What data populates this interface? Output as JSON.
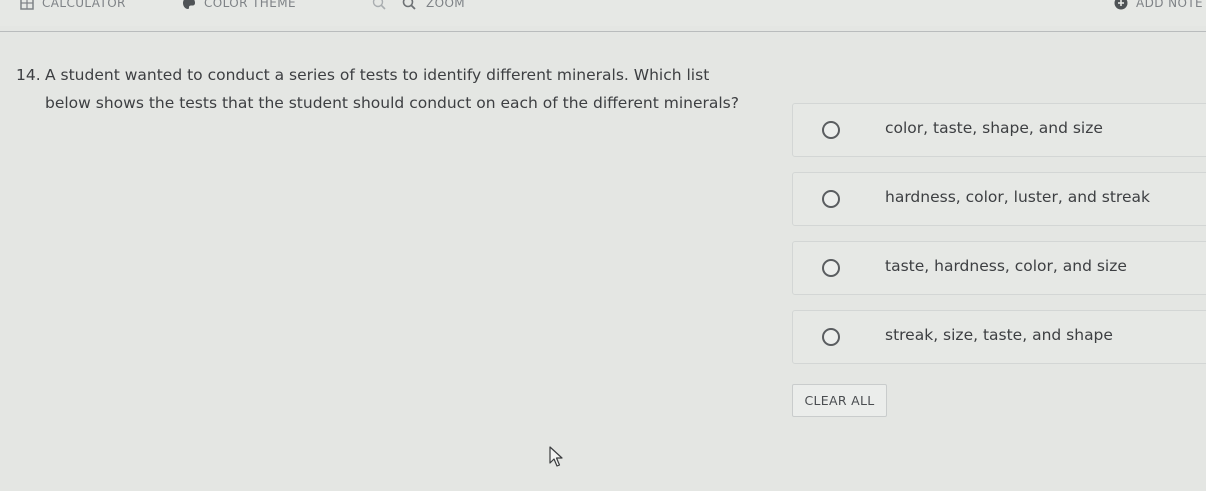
{
  "toolbar": {
    "calculator_label": "CALCULATOR",
    "color_theme_label": "COLOR THEME",
    "zoom_label": "ZOOM",
    "add_note_label": "ADD NOTE",
    "icons": [
      "calculator-icon",
      "palette-icon",
      "zoom-out-icon",
      "zoom-in-icon",
      "plus-circle-icon"
    ]
  },
  "question": {
    "number": "14.",
    "text": "A student wanted to conduct a series of tests to identify different minerals. Which list below shows the tests that the student should conduct on each of the different minerals?"
  },
  "options": [
    {
      "label": "color, taste, shape, and size",
      "selected": false
    },
    {
      "label": "hardness, color, luster, and streak",
      "selected": false
    },
    {
      "label": "taste, hardness, color, and size",
      "selected": false
    },
    {
      "label": "streak, size, taste, and shape",
      "selected": false
    }
  ],
  "clear_button_label": "CLEAR ALL",
  "colors": {
    "background": "#e4e6e3",
    "text": "#3d3f42",
    "toolbar_text": "#7e8286",
    "option_border": "#d3d6d5"
  }
}
